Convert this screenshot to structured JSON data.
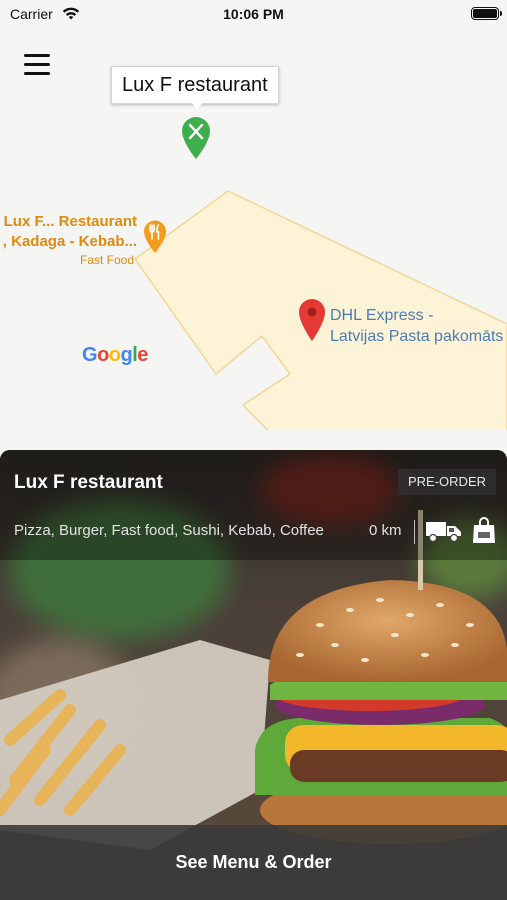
{
  "status_bar": {
    "carrier": "Carrier",
    "time": "10:06 PM"
  },
  "map": {
    "callout_title": "Lux F restaurant",
    "poi_restaurant": {
      "line1": "Lux F... Restaurant",
      "line2": ", Kadaga - Kebab...",
      "category": "Fast Food"
    },
    "poi_dhl": {
      "line1": "DHL Express -",
      "line2": "Latvijas Pasta pakomāts"
    },
    "google_logo": "Google"
  },
  "card": {
    "title": "Lux F restaurant",
    "badge": "PRE-ORDER",
    "categories": "Pizza, Burger, Fast food, Sushi, Kebab, Coffee",
    "distance": "0 km",
    "delivery_icon": "delivery-truck-icon",
    "takeaway_icon": "shopping-bag-icon",
    "cta_label": "See Menu & Order"
  },
  "colors": {
    "pin_green": "#3fae4d",
    "pin_orange": "#f29b1d",
    "pin_red": "#e53935",
    "poi_orange": "#e08a0e",
    "dhl_blue": "#4a7cb8",
    "road_fill": "#fdf3d6",
    "road_border": "#f2d79a"
  }
}
